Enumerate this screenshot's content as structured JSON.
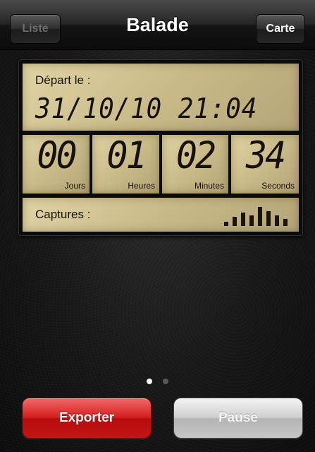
{
  "navbar": {
    "title": "Balade",
    "left_button": "Liste",
    "right_button": "Carte"
  },
  "lcd": {
    "depart_label": "Départ le :",
    "depart_value": "31/10/10 21:04",
    "timer": [
      {
        "value": "00",
        "unit": "Jours"
      },
      {
        "value": "01",
        "unit": "Heures"
      },
      {
        "value": "02",
        "unit": "Minutes"
      },
      {
        "value": "34",
        "unit": "Seconds"
      }
    ],
    "captures_label": "Captures :",
    "captures_icon": "signal-bars-icon"
  },
  "pager": {
    "pages": 2,
    "active": 1
  },
  "buttons": {
    "export": "Exporter",
    "pause": "Pause"
  },
  "colors": {
    "lcd_background": "#d2c494",
    "export_red": "#d41e1e",
    "pause_gray": "#c6c6c6"
  }
}
